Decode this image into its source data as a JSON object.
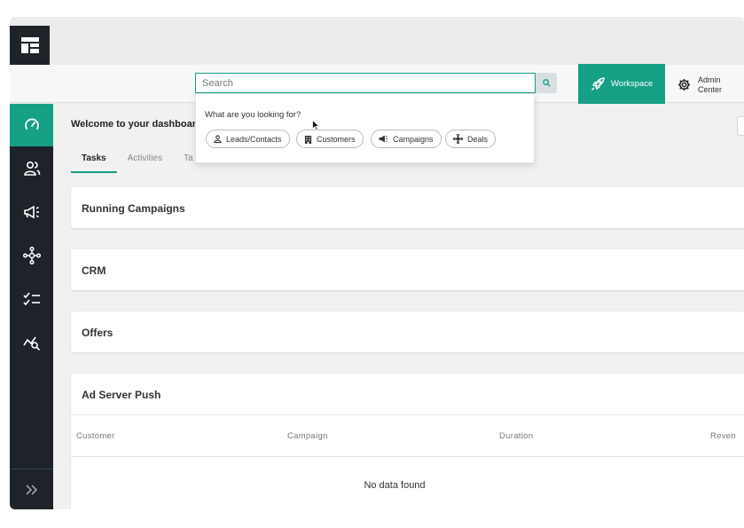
{
  "search": {
    "placeholder": "Search"
  },
  "dropdown": {
    "label": "What are you looking for?",
    "chips": [
      {
        "label": "Leads/Contacts",
        "icon": "person-icon"
      },
      {
        "label": "Customers",
        "icon": "building-icon"
      },
      {
        "label": "Campaigns",
        "icon": "megaphone-icon"
      },
      {
        "label": "Deals",
        "icon": "network-icon"
      }
    ]
  },
  "header": {
    "workspace_label": "Workspace",
    "admin_label_line1": "Admin",
    "admin_label_line2": "Center"
  },
  "main": {
    "welcome": "Welcome to your dashboard,",
    "tabs": [
      {
        "label": "Tasks",
        "active": true
      },
      {
        "label": "Activities",
        "active": false
      },
      {
        "label": "Ta",
        "active": false
      }
    ],
    "cards": [
      {
        "title": "Running Campaigns"
      },
      {
        "title": "CRM"
      },
      {
        "title": "Offers"
      },
      {
        "title": "Ad Server Push"
      }
    ],
    "ad_server_table": {
      "columns": [
        "Customer",
        "Campaign",
        "Duration",
        "Reven"
      ],
      "empty_text": "No data found"
    }
  },
  "sidebar": {
    "items": [
      {
        "icon": "dashboard-gauge-icon",
        "active": true
      },
      {
        "icon": "users-icon",
        "active": false
      },
      {
        "icon": "megaphone-icon",
        "active": false
      },
      {
        "icon": "network-icon",
        "active": false
      },
      {
        "icon": "checklist-icon",
        "active": false
      },
      {
        "icon": "chart-search-icon",
        "active": false
      }
    ],
    "expand_icon": "double-chevron-right-icon"
  },
  "colors": {
    "accent": "#16a085",
    "sidebar_bg": "#1d2329",
    "page_bg": "#f1f1f1"
  }
}
